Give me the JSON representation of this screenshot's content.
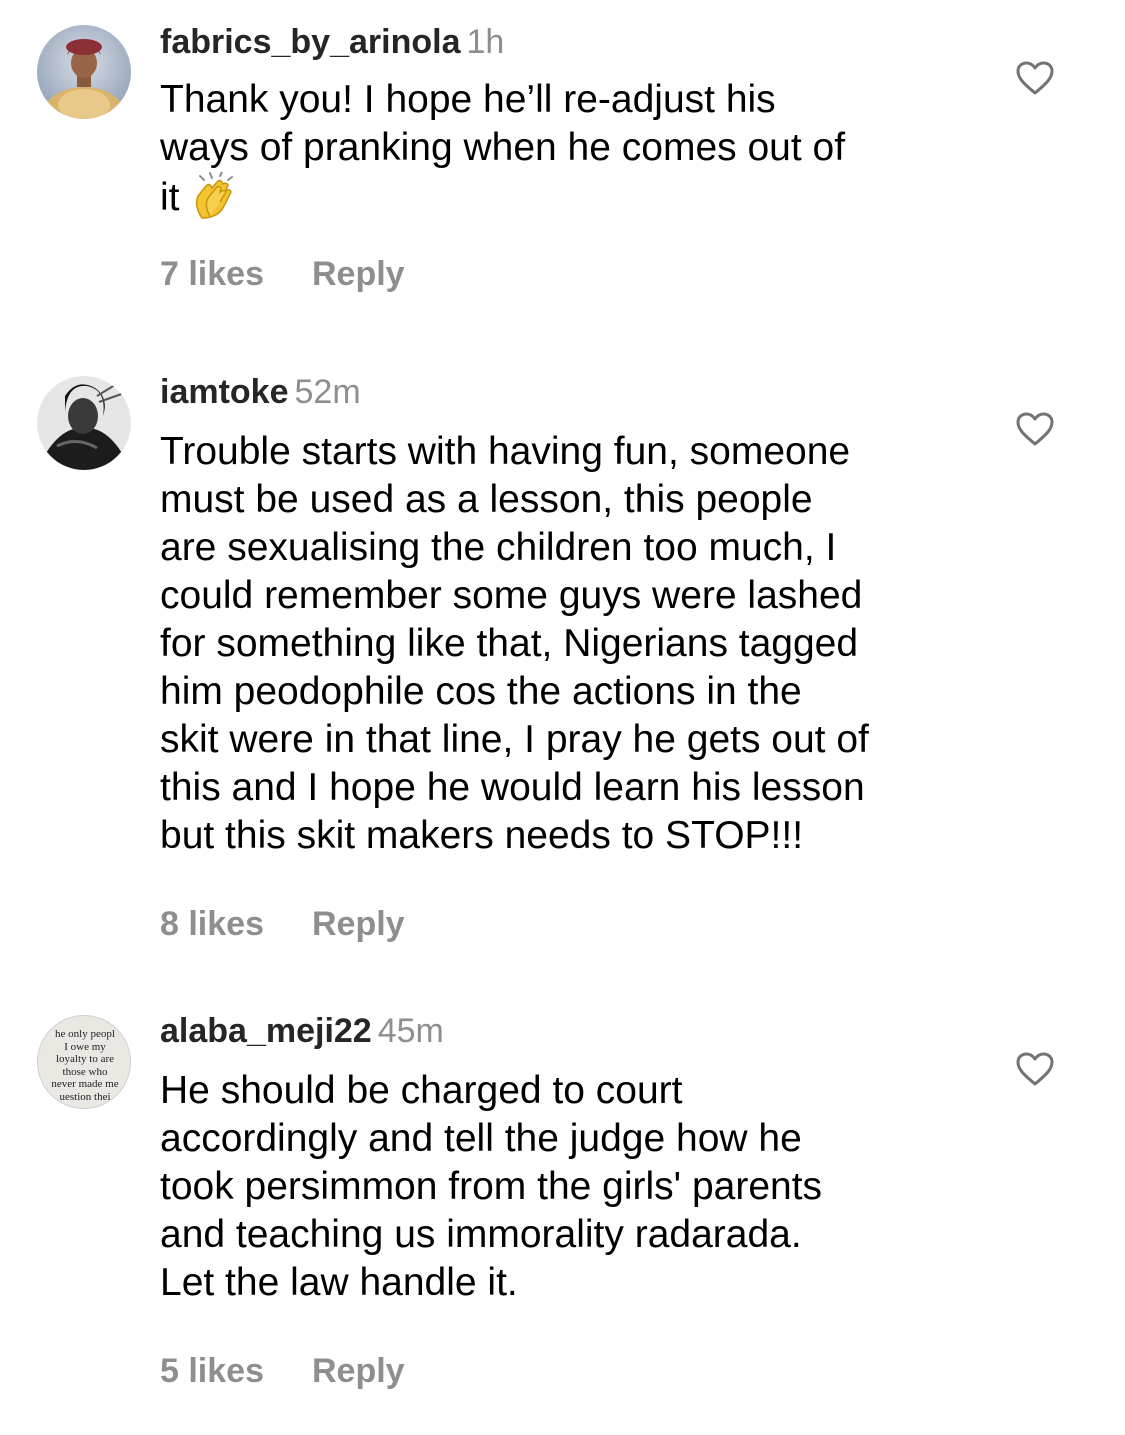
{
  "comments": [
    {
      "username": "fabrics_by_arinola",
      "time": "1h",
      "lines": [
        "Thank you! I hope he’ll re-adjust his",
        "ways of pranking when he comes out of",
        "it"
      ],
      "emoji": "clapping-hands",
      "likes": "7 likes",
      "reply": "Reply",
      "avatar_icon": "profile-photo-woman-gold-dress"
    },
    {
      "username": "iamtoke",
      "time": "52m",
      "lines": [
        "Trouble starts with having fun, someone",
        "must be used as a lesson, this people",
        "are sexualising the children too much, I",
        "could remember some guys were lashed",
        "for something like that, Nigerians tagged",
        "him peodophile cos  the actions in the",
        "skit were in that line, I pray he gets out of",
        "this and I hope he would learn his lesson",
        "but this skit makers needs to STOP!!!"
      ],
      "likes": "8 likes",
      "reply": "Reply",
      "avatar_icon": "profile-photo-bw-portrait"
    },
    {
      "username": "alaba_meji22",
      "time": "45m",
      "lines": [
        "He should be charged to court",
        "accordingly and tell the judge how he",
        "took persimmon from the girls' parents",
        "and teaching us immorality radarada.",
        "Let the law handle it."
      ],
      "likes": "5 likes",
      "reply": "Reply",
      "avatar_icon": "profile-photo-text-quote",
      "avatar_text": [
        "he only peopl",
        "I owe my",
        "loyalty to are",
        "those who",
        "never made me",
        "uestion thei"
      ]
    }
  ],
  "colors": {
    "text": "#000000",
    "username": "#262626",
    "secondary": "#8e8e8e"
  }
}
